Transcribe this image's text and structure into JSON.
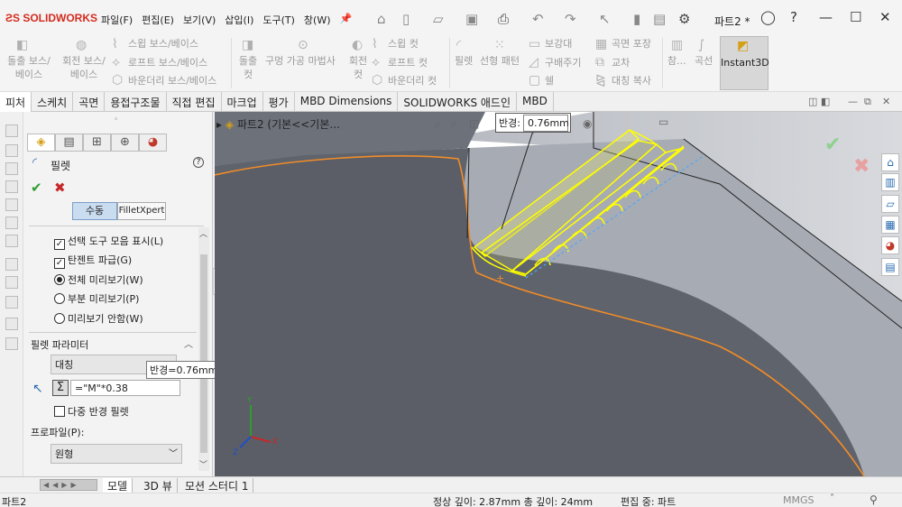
{
  "app": {
    "logo": "SOLIDWORKS",
    "doc_name": "파트2 *"
  },
  "menu": [
    "파일(F)",
    "편집(E)",
    "보기(V)",
    "삽입(I)",
    "도구(T)",
    "창(W)"
  ],
  "ribbon": {
    "extrude_boss": "돌출 보스/\n베이스",
    "revolve_boss": "회전 보스/\n베이스",
    "sweep_boss": "스윕 보스/베이스",
    "loft_boss": "로프트 보스/베이스",
    "boundary_boss": "바운더리 보스/베이스",
    "extrude_cut": "돌출\n컷",
    "hole_wizard": "구멍 가공 마법사",
    "revolve_cut": "회전\n컷",
    "sweep_cut": "스윕 컷",
    "loft_cut": "로프트 컷",
    "boundary_cut": "바운더리 컷",
    "fillet": "필렛",
    "linear_pattern": "선형 패턴",
    "rib": "보강대",
    "draft": "구배주기",
    "shell": "쉘",
    "wrap": "곡면 포장",
    "intersect": "교차",
    "mirror": "대칭 복사",
    "reference": "참...",
    "curves": "곡선",
    "instant3d": "Instant3D"
  },
  "tabs": [
    "피처",
    "스케치",
    "곡면",
    "용접구조물",
    "직접 편집",
    "마크업",
    "평가",
    "MBD Dimensions",
    "SOLIDWORKS 애드인",
    "MBD"
  ],
  "property_manager": {
    "title": "필렛",
    "help": "?",
    "mode_manual": "수동",
    "mode_expert": "FilletXpert",
    "options": {
      "show_toolbar": "선택 도구 모음 표시(L)",
      "tangent_propagation": "탄젠트 파급(G)",
      "full_preview": "전체 미리보기(W)",
      "partial_preview": "부분 미리보기(P)",
      "no_preview": "미리보기 안함(W)"
    },
    "params_header": "필렛 파라미터",
    "symmetric": "대칭",
    "radius_value": "=\"M\"*0.38",
    "radius_tooltip": "반경=0.76mm",
    "multi_radius": "다중 반경 필렛",
    "profile_label": "프로파일(P):",
    "profile_value": "원형"
  },
  "viewport": {
    "breadcrumb": "파트2  (기본<<기본...",
    "callout_label": "반경:",
    "callout_value": "0.76mm"
  },
  "bottom_tabs": [
    "모델",
    "3D 뷰",
    "모션 스터디 1"
  ],
  "status": {
    "left": "파트2",
    "depth": "정상 깊이: 2.87mm 총 깊이: 24mm",
    "editing": "편집 중: 파트",
    "units": "MMGS"
  },
  "colors": {
    "accent": "#d52b1e",
    "highlight": "#ffff00",
    "edge": "#f28c28"
  }
}
